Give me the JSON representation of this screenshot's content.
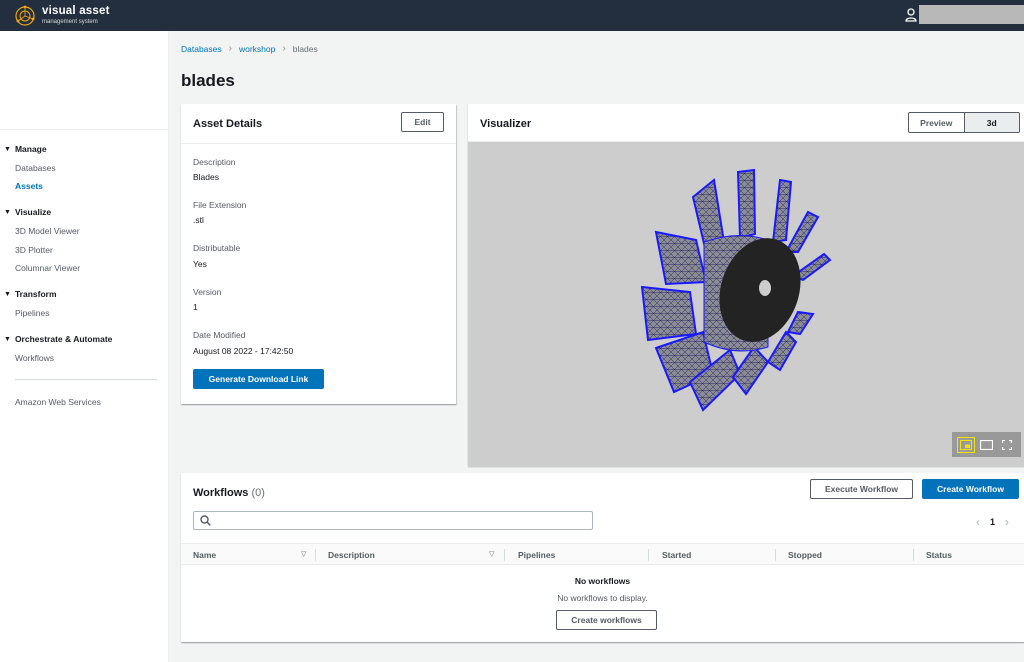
{
  "app": {
    "title": "visual asset",
    "subtitle": "management system"
  },
  "colors": {
    "topbar": "#232f3e",
    "link": "#0073bb",
    "primary": "#0073bb",
    "mesh": "#1a1aff",
    "viewer_bg": "#cdcdcd"
  },
  "sidebar": {
    "sections": [
      {
        "label": "Manage",
        "items": [
          "Databases",
          "Assets"
        ]
      },
      {
        "label": "Visualize",
        "items": [
          "3D Model Viewer",
          "3D Plotter",
          "Columnar Viewer"
        ]
      },
      {
        "label": "Transform",
        "items": [
          "Pipelines"
        ]
      },
      {
        "label": "Orchestrate & Automate",
        "items": [
          "Workflows"
        ]
      }
    ],
    "active_item": "Assets",
    "footer_link": "Amazon Web Services"
  },
  "breadcrumb": [
    "Databases",
    "workshop",
    "blades"
  ],
  "page_title": "blades",
  "asset_details": {
    "title": "Asset Details",
    "edit_label": "Edit",
    "fields": [
      {
        "label": "Description",
        "value": "Blades"
      },
      {
        "label": "File Extension",
        "value": ".stl"
      },
      {
        "label": "Distributable",
        "value": "Yes"
      },
      {
        "label": "Version",
        "value": "1"
      },
      {
        "label": "Date Modified",
        "value": "August 08 2022 - 17:42:50"
      }
    ],
    "download_label": "Generate Download Link"
  },
  "visualizer": {
    "title": "Visualizer",
    "modes": [
      "Preview",
      "3d"
    ],
    "selected_mode": "3d",
    "controls": [
      "picture-in-picture-icon",
      "window-icon",
      "fullscreen-icon"
    ]
  },
  "workflows": {
    "title": "Workflows",
    "count": "(0)",
    "execute_label": "Execute Workflow",
    "create_label": "Create Workflow",
    "search_placeholder": "",
    "page": "1",
    "columns": [
      "Name",
      "Description",
      "Pipelines",
      "Started",
      "Stopped",
      "Status"
    ],
    "empty_title": "No workflows",
    "empty_message": "No workflows to display.",
    "empty_button": "Create workflows"
  }
}
